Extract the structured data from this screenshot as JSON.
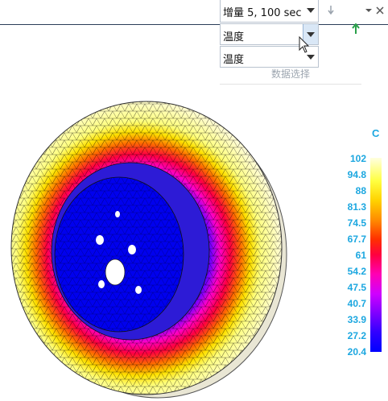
{
  "toolbar": {
    "increment_value": "增量 5, 100 sec",
    "result_value": "温度",
    "component_value": "温度",
    "section_label": "数据选择",
    "icons": [
      "pin-icon",
      "close-icon",
      "up-arrow-icon",
      "mouse-cursor-icon"
    ]
  },
  "legend": {
    "unit": "C",
    "labels": [
      "102",
      "94.8",
      "88",
      "81.3",
      "74.5",
      "67.7",
      "61",
      "54.2",
      "47.5",
      "40.7",
      "33.9",
      "27.2",
      "20.4"
    ],
    "colors": {
      "max": "#ffffe0",
      "high": "#ffff40",
      "mid": "#ff0040",
      "low": "#0000ff",
      "label": "#1ca7e0"
    }
  },
  "view": {
    "model": "brake-disc-temperature-mesh",
    "mesh_color": "#000000"
  }
}
